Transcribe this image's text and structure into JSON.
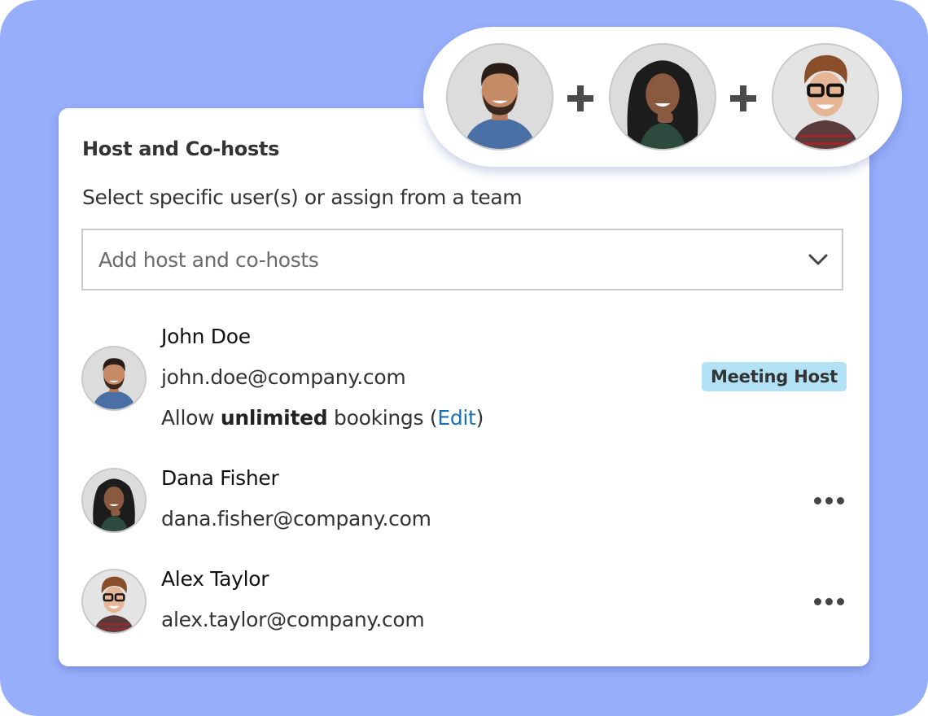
{
  "panel": {
    "title": "Host and Co-hosts",
    "subtitle": "Select specific user(s) or assign from a team",
    "select": {
      "placeholder": "Add host and co-hosts",
      "icon": "chevron-down-icon"
    }
  },
  "users": [
    {
      "name": "John Doe",
      "email": "john.doe@company.com",
      "booking_prefix": "Allow ",
      "booking_bold": "unlimited",
      "booking_suffix": " bookings (",
      "booking_link": "Edit",
      "booking_close": ")",
      "badge": "Meeting Host",
      "avatar": "man-beard-avatar"
    },
    {
      "name": "Dana Fisher",
      "email": "dana.fisher@company.com",
      "menu_icon": "more-horizontal-icon",
      "avatar": "woman-curly-hair-avatar"
    },
    {
      "name": "Alex Taylor",
      "email": "alex.taylor@company.com",
      "menu_icon": "more-horizontal-icon",
      "avatar": "man-glasses-avatar"
    }
  ],
  "header_pill": {
    "avatars": [
      "man-beard-avatar",
      "woman-curly-hair-avatar",
      "man-glasses-avatar"
    ],
    "separator_icon": "plus-icon"
  },
  "colors": {
    "background": "#97aefb",
    "badge_bg": "#b3e2f6",
    "link": "#1a6fb5"
  }
}
